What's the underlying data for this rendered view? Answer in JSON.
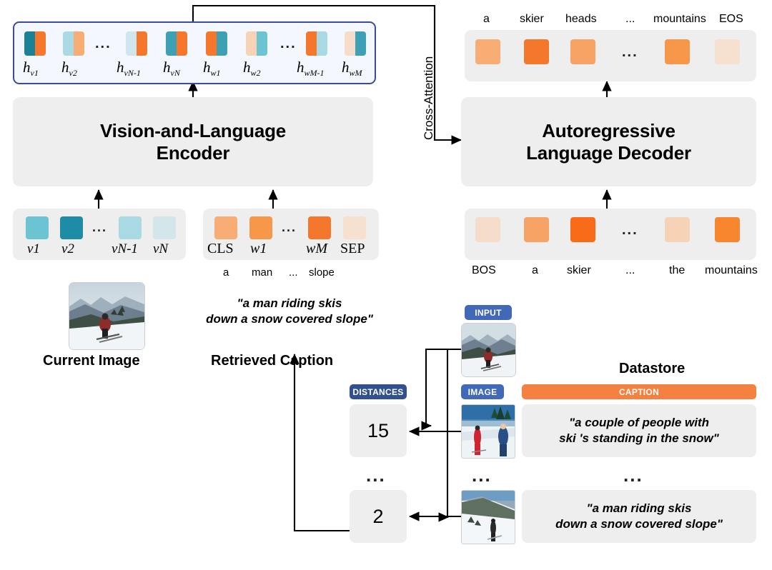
{
  "encoder": {
    "title_line1": "Vision-and-Language",
    "title_line2": "Encoder",
    "hidden_states": [
      {
        "label": "h",
        "sub": "v₁"
      },
      {
        "label": "h",
        "sub": "v₂"
      },
      {
        "label": "h",
        "sub": "vₙ₋₁"
      },
      {
        "label": "h",
        "sub": "vₙ"
      },
      {
        "label": "h",
        "sub": "w₁"
      },
      {
        "label": "h",
        "sub": "w₂"
      },
      {
        "label": "h",
        "sub": "wₘ₋₁"
      },
      {
        "label": "h",
        "sub": "wₘ"
      }
    ],
    "hidden_labels": [
      "h",
      "h",
      "h",
      "h",
      "h",
      "h",
      "h",
      "h"
    ],
    "hidden_subs": [
      "v1",
      "v2",
      "vN-1",
      "vN",
      "w1",
      "w2",
      "wM-1",
      "wM"
    ],
    "vision_tokens": [
      "v1",
      "v2",
      "vN-1",
      "vN"
    ],
    "text_tokens": [
      "CLS",
      "w1",
      "wM",
      "SEP"
    ],
    "text_words": [
      "a",
      "man",
      "...",
      "slope"
    ],
    "ellipsis": "..."
  },
  "decoder": {
    "title_line1": "Autoregressive",
    "title_line2": "Language Decoder",
    "output_tokens": [
      "a",
      "skier",
      "heads",
      "...",
      "mountains",
      "EOS"
    ],
    "input_tokens": [
      "BOS",
      "a",
      "skier",
      "...",
      "the",
      "mountains"
    ],
    "ellipsis": "..."
  },
  "cross_attention_label": "Cross-Attention",
  "current_image": {
    "caption_label": "Current Image"
  },
  "retrieved_caption": {
    "label": "Retrieved Caption",
    "text_line1": "\"a man riding skis",
    "text_line2": "down a snow covered slope\""
  },
  "datastore": {
    "title": "Datastore",
    "input_badge": "INPUT",
    "headers": {
      "distances": "DISTANCES",
      "image": "IMAGE",
      "caption": "CAPTION"
    },
    "rows": [
      {
        "distance": "15",
        "caption_line1": "\"a couple of people with",
        "caption_line2": "ski 's standing in the snow\""
      },
      {
        "distance": "2",
        "caption_line1": "\"a man riding skis",
        "caption_line2": "down a snow covered slope\""
      }
    ],
    "ellipsis": "..."
  },
  "colors": {
    "teal_dark": "#1f8ca6",
    "teal_mid": "#6cc3d1",
    "teal_light": "#a9d9e2",
    "teal_pale": "#d3e6ea",
    "orange_dark": "#f4772b",
    "orange_mid": "#f7974a",
    "orange_light": "#f7ad73",
    "orange_pale": "#f6e0cf",
    "badge_navy": "#32508f",
    "badge_blue": "#4169b8",
    "badge_orange": "#f4813f",
    "box_gray": "#eeeeee",
    "hidden_border": "#3b4c9b"
  }
}
